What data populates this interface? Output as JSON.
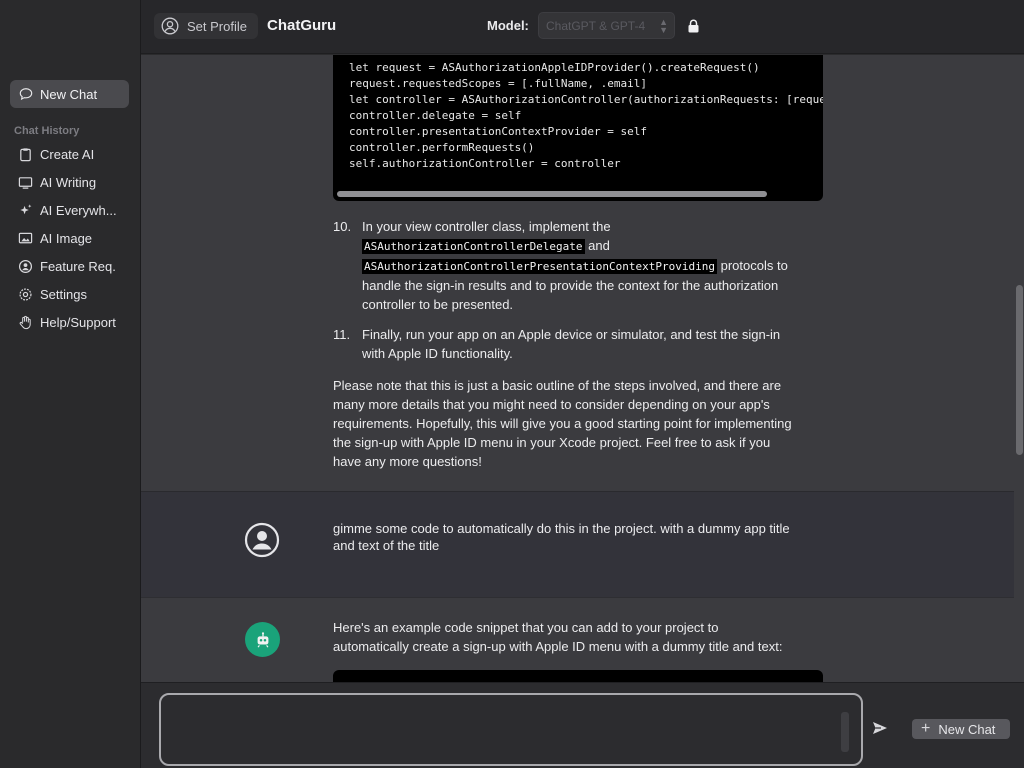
{
  "sidebar": {
    "new_chat_label": "New Chat",
    "history_label": "Chat History",
    "items": [
      {
        "label": "Create AI",
        "icon": "clipboard-icon"
      },
      {
        "label": "AI Writing",
        "icon": "monitor-icon"
      },
      {
        "label": "AI Everywh...",
        "icon": "sparkle-icon"
      },
      {
        "label": "AI Image",
        "icon": "image-icon"
      },
      {
        "label": "Feature Req.",
        "icon": "person-circle-icon"
      },
      {
        "label": "Settings",
        "icon": "gear-icon"
      },
      {
        "label": "Help/Support",
        "icon": "hand-icon"
      }
    ]
  },
  "header": {
    "set_profile_label": "Set Profile",
    "brand": "ChatGuru",
    "model_label": "Model:",
    "model_value": "ChatGPT & GPT-4"
  },
  "conversation": {
    "code_lines": [
      "let request = ASAuthorizationAppleIDProvider().createRequest()",
      "request.requestedScopes = [.fullName, .email]",
      "let controller = ASAuthorizationController(authorizationRequests: [request])",
      "controller.delegate = self",
      "controller.presentationContextProvider = self",
      "controller.performRequests()",
      "self.authorizationController = controller"
    ],
    "step10": {
      "number": "10.",
      "text_before": "In your view controller class, implement the",
      "code1": "ASAuthorizationControllerDelegate",
      "and": " and",
      "code2": "ASAuthorizationControllerPresentationContextProviding",
      "text_after_inline": " protocols to",
      "line3": "handle the sign-in results and to provide the context for the authorization",
      "line4": "controller to be presented."
    },
    "step11": {
      "number": "11.",
      "line1": "Finally, run your app on an Apple device or simulator, and test the sign-in",
      "line2": "with Apple ID functionality."
    },
    "closing_lines": [
      "Please note that this is just a basic outline of the steps involved, and there are",
      "many more details that you might need to consider depending on your app's",
      "requirements. Hopefully, this will give you a good starting point for implementing",
      "the sign-up with Apple ID menu in your Xcode project. Feel free to ask if you",
      "have any more questions!"
    ],
    "user_message_lines": [
      "gimme some code to automatically do this in the project. with a dummy app title",
      "and text of the title"
    ],
    "bot_message_lines": [
      "Here's an example code snippet that you can add to your project to",
      "automatically create a sign-up with Apple ID menu with a dummy title and text:"
    ]
  },
  "composer": {
    "placeholder": "",
    "new_chat_label": "New Chat"
  }
}
